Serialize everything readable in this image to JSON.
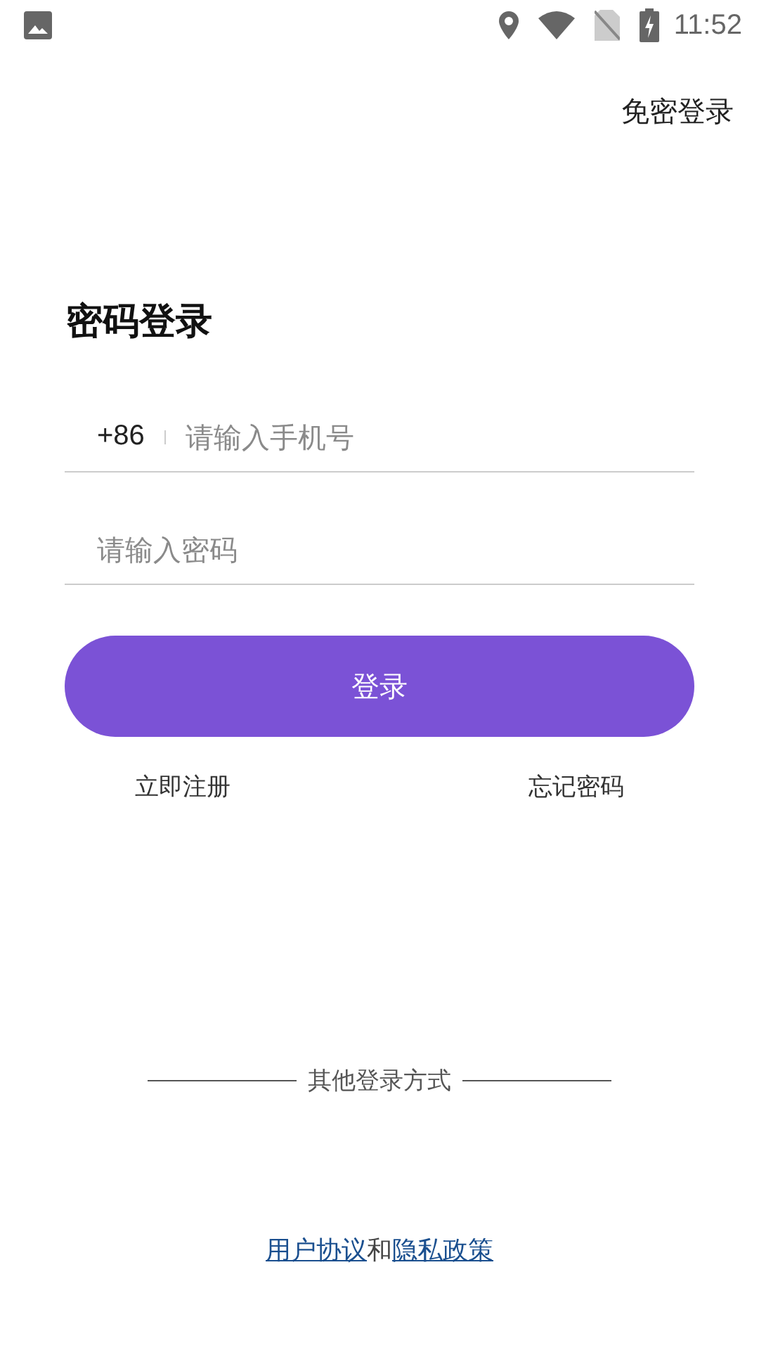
{
  "status_bar": {
    "time": "11:52"
  },
  "top_link": "免密登录",
  "title": "密码登录",
  "phone": {
    "prefix": "+86",
    "placeholder": "请输入手机号"
  },
  "password": {
    "placeholder": "请输入密码"
  },
  "login_button": "登录",
  "links": [
    "立即注册",
    "忘记密码"
  ],
  "other_login": "其他登录方式",
  "agreement": {
    "first": "用户协议",
    "joiner": "和",
    "second": "隐私政策"
  }
}
